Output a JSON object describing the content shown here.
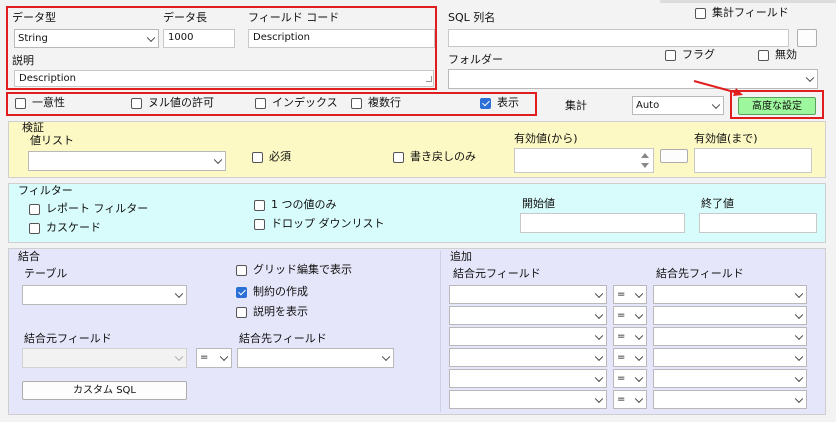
{
  "top": {
    "data_type_label": "データ型",
    "data_type_value": "String",
    "data_length_label": "データ長",
    "data_length_value": "1000",
    "field_code_label": "フィールド コード",
    "field_code_value": "Description",
    "description_label": "説明",
    "description_value": "Description",
    "sql_column_label": "SQL 列名",
    "aggregate_field_label": "集計フィールド",
    "folder_label": "フォルダー",
    "flag_label": "フラグ",
    "disabled_label": "無効"
  },
  "options": {
    "unique_label": "一意性",
    "allow_null_label": "ヌル値の許可",
    "index_label": "インデックス",
    "multiline_label": "複数行",
    "display_label": "表示",
    "aggregate_label": "集計",
    "aggregate_value": "Auto",
    "advanced_button": "高度な設定"
  },
  "validation": {
    "title": "検証",
    "value_list_label": "値リスト",
    "required_label": "必須",
    "writeback_only_label": "書き戻しのみ",
    "valid_from_label": "有効値(から)",
    "valid_to_label": "有効値(まで)"
  },
  "filter": {
    "title": "フィルター",
    "report_filter_label": "レポート フィルター",
    "cascade_label": "カスケード",
    "single_value_label": "1 つの値のみ",
    "dropdown_list_label": "ドロップ ダウンリスト",
    "start_value_label": "開始値",
    "end_value_label": "終了値"
  },
  "join": {
    "title": "結合",
    "table_label": "テーブル",
    "grid_edit_label": "グリッド編集で表示",
    "create_constraint_label": "制約の作成",
    "show_description_label": "説明を表示",
    "source_field_label": "結合元フィールド",
    "target_field_label": "結合先フィールド",
    "operator_value": "=",
    "custom_sql_button": "カスタム SQL"
  },
  "additional": {
    "title": "追加",
    "source_field_label": "結合元フィールド",
    "target_field_label": "結合先フィールド",
    "rows": [
      {
        "operator": "="
      },
      {
        "operator": "="
      },
      {
        "operator": "="
      },
      {
        "operator": "="
      },
      {
        "operator": "="
      },
      {
        "operator": "="
      }
    ]
  },
  "checks": {
    "aggregate_field": false,
    "flag": false,
    "disabled": false,
    "unique": false,
    "allow_null": false,
    "index": false,
    "multiline": false,
    "display": true,
    "required": false,
    "writeback_only": false,
    "report_filter": false,
    "cascade": false,
    "single_value": false,
    "dropdown_list": false,
    "grid_edit": false,
    "create_constraint": true,
    "show_description": false
  },
  "colors": {
    "validation_bg": "#fdf9c4",
    "filter_bg": "#d8fbfb",
    "join_bg": "#e6e6fb",
    "highlight_border": "#e01e1e",
    "advanced_button_bg": "#9df79d"
  }
}
